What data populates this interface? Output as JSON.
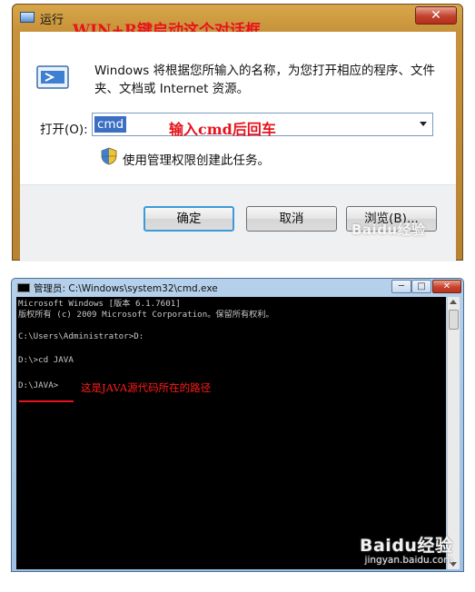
{
  "run_dialog": {
    "title": "运行",
    "overlay_title": "WIN+R键启动这个对话框",
    "close_label": "✕",
    "description": "Windows 将根据您所输入的名称，为您打开相应的程序、文件夹、文档或 Internet 资源。",
    "open_label": "打开(O):",
    "open_value": "cmd",
    "open_hint": "输入cmd后回车",
    "admin_note": "使用管理权限创建此任务。",
    "ok_label": "确定",
    "cancel_label": "取消",
    "browse_label": "浏览(B)...",
    "watermark": "Baidu经验"
  },
  "cmd_window": {
    "title": "管理员: C:\\Windows\\system32\\cmd.exe",
    "min_label": "─",
    "max_label": "□",
    "close_label": "✕",
    "lines": [
      "Microsoft Windows [版本 6.1.7601]",
      "版权所有 (c) 2009 Microsoft Corporation。保留所有权利。",
      "",
      "C:\\Users\\Administrator>D:",
      "",
      "D:\\>cd JAVA",
      "",
      "D:\\JAVA>"
    ],
    "annotation": "这是JAVA源代码所在的路径",
    "watermark_logo": "Baidu经验",
    "watermark_url": "jingyan.baidu.com"
  },
  "colors": {
    "annotation_red": "#e8121b",
    "run_frame": "#c7923a",
    "console_bg": "#000000",
    "console_text": "#c8c8c8"
  }
}
